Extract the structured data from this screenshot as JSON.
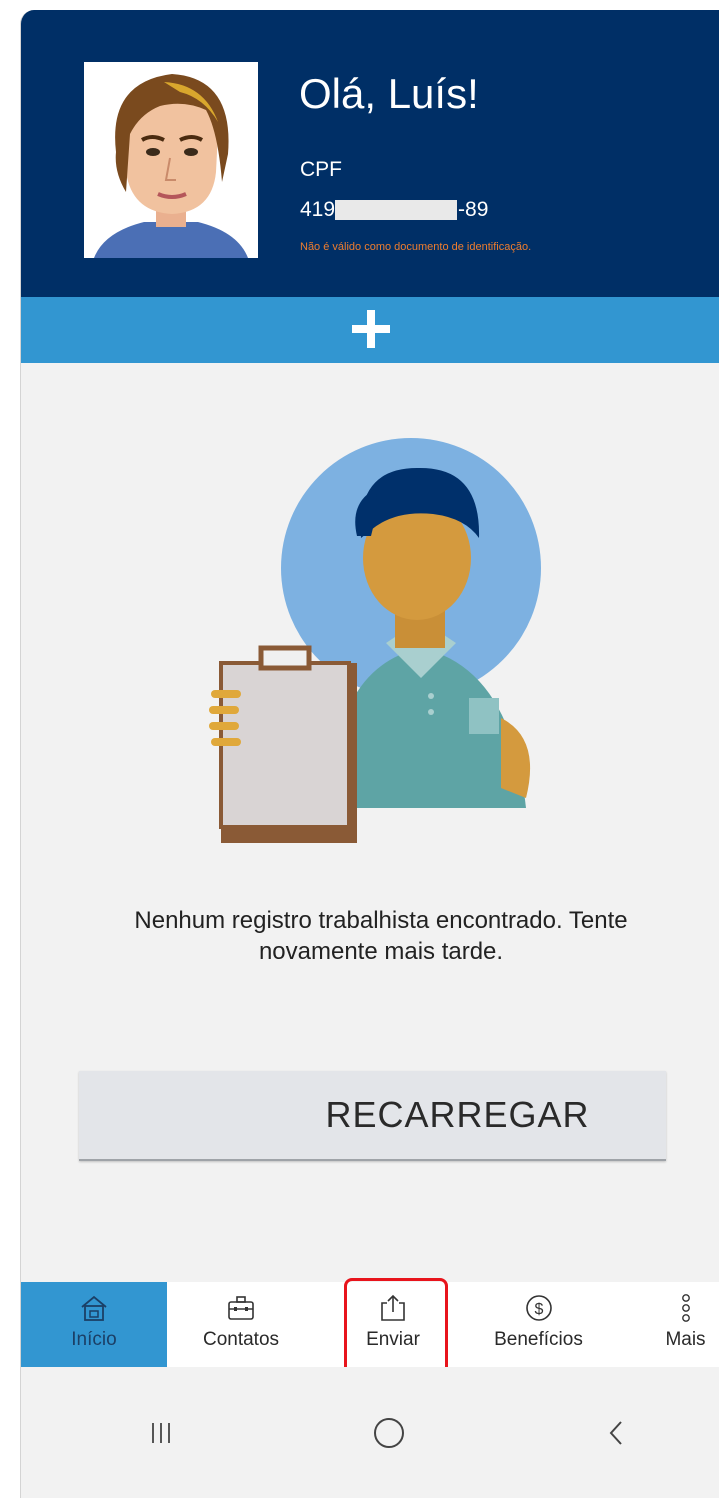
{
  "header": {
    "greeting": "Olá, Luís!",
    "cpf_label": "CPF",
    "cpf_prefix": "419",
    "cpf_suffix": "-89",
    "disclaimer": "Não é válido como documento de identificação."
  },
  "expand_bar": {
    "icon": "plus-icon"
  },
  "empty_state": {
    "message": "Nenhum registro trabalhista encontrado. Tente novamente mais tarde."
  },
  "reload_button": {
    "label": "RECARREGAR"
  },
  "bottom_nav": {
    "items": [
      {
        "label": "Início",
        "icon": "home-icon",
        "active": true
      },
      {
        "label": "Contatos",
        "icon": "briefcase-icon",
        "active": false
      },
      {
        "label": "Enviar",
        "icon": "share-upload-icon",
        "active": false
      },
      {
        "label": "Benefícios",
        "icon": "dollar-icon",
        "active": false
      },
      {
        "label": "Mais",
        "icon": "more-dots-icon",
        "active": false
      }
    ]
  },
  "highlight": {
    "target": "Enviar",
    "color": "#e8141c"
  },
  "system_nav": {
    "buttons": [
      "recent-apps-icon",
      "home-circle-icon",
      "back-icon"
    ]
  },
  "colors": {
    "header_bg": "#002f66",
    "accent_blue": "#3296d1",
    "disclaimer": "#ee7d2e",
    "page_bg": "#f2f2f2"
  }
}
